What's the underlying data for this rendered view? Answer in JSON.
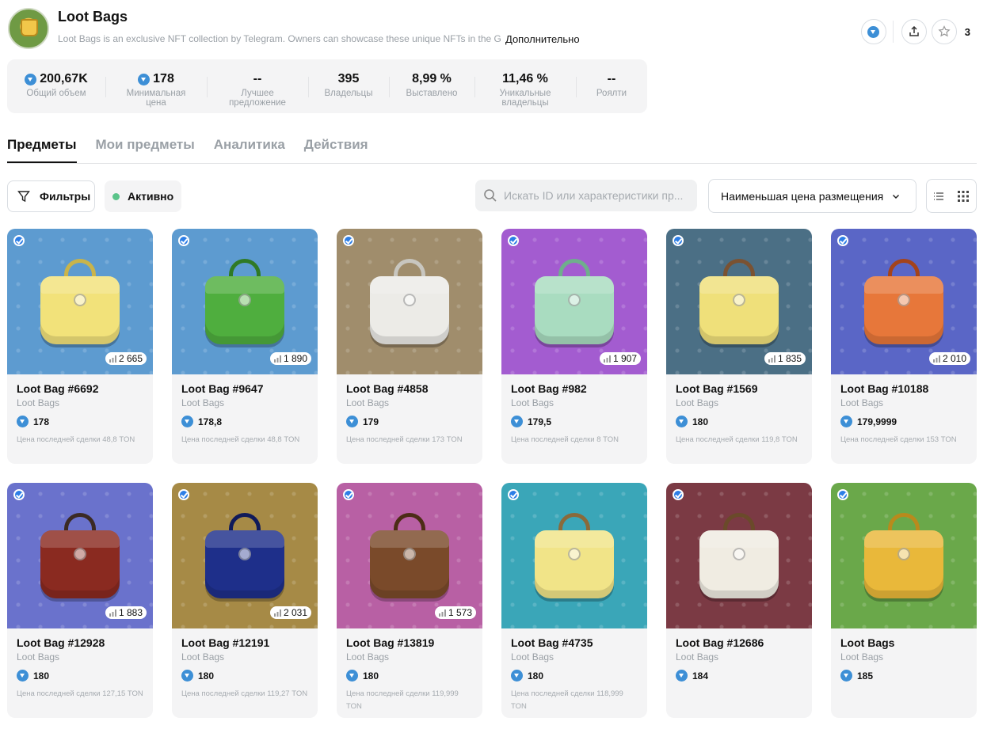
{
  "collection": {
    "title": "Loot Bags",
    "description": "Loot Bags is an exclusive NFT collection by Telegram. Owners can showcase these unique NFTs in the G",
    "more_link": "Дополнительно",
    "favorites_count": "3"
  },
  "stats": [
    {
      "value": "200,67K",
      "label": "Общий объем",
      "has_ton": true
    },
    {
      "value": "178",
      "label": "Минимальная цена",
      "has_ton": true
    },
    {
      "value": "--",
      "label": "Лучшее предложение",
      "has_ton": false
    },
    {
      "value": "395",
      "label": "Владельцы",
      "has_ton": false
    },
    {
      "value": "8,99 %",
      "label": "Выставлено",
      "has_ton": false
    },
    {
      "value": "11,46 %",
      "label": "Уникальные владельцы",
      "has_ton": false
    },
    {
      "value": "--",
      "label": "Роялти",
      "has_ton": false
    }
  ],
  "tabs": [
    {
      "label": "Предметы",
      "active": true
    },
    {
      "label": "Мои предметы",
      "active": false
    },
    {
      "label": "Аналитика",
      "active": false
    },
    {
      "label": "Действия",
      "active": false
    }
  ],
  "toolbar": {
    "filters_label": "Фильтры",
    "status_label": "Активно",
    "search_placeholder": "Искать ID или характеристики пр...",
    "sort_label": "Наименьшая цена размещения"
  },
  "items": [
    {
      "name": "Loot Bag #6692",
      "collection": "Loot Bags",
      "price": "178",
      "last_label": "Цена последней сделки",
      "last_price": "48,8 TON",
      "holders": "2 665",
      "bg": "#5d9bd0",
      "bag": "#f2e27a",
      "handle": "#c9b44a"
    },
    {
      "name": "Loot Bag #9647",
      "collection": "Loot Bags",
      "price": "178,8",
      "last_label": "Цена последней сделки",
      "last_price": "48,8 TON",
      "holders": "1 890",
      "bg": "#5d9bd0",
      "bag": "#4fae3e",
      "handle": "#2f7a25"
    },
    {
      "name": "Loot Bag #4858",
      "collection": "Loot Bags",
      "price": "179",
      "last_label": "Цена последней сделки",
      "last_price": "173 TON",
      "holders": "",
      "bg": "#a08d6c",
      "bag": "#ecebe7",
      "handle": "#c8c6bf"
    },
    {
      "name": "Loot Bag #982",
      "collection": "Loot Bags",
      "price": "179,5",
      "last_label": "Цена последней сделки",
      "last_price": "8 TON",
      "holders": "1 907",
      "bg": "#a35cd0",
      "bag": "#a9dcc0",
      "handle": "#6fae8c"
    },
    {
      "name": "Loot Bag #1569",
      "collection": "Loot Bags",
      "price": "180",
      "last_label": "Цена последней сделки",
      "last_price": "119,8 TON",
      "holders": "1 835",
      "bg": "#4b6f85",
      "bag": "#efe07a",
      "handle": "#7a5232"
    },
    {
      "name": "Loot Bag #10188",
      "collection": "Loot Bags",
      "price": "179,9999",
      "last_label": "Цена последней сделки",
      "last_price": "153 TON",
      "holders": "2 010",
      "bg": "#5a66c6",
      "bag": "#e7773a",
      "handle": "#a4431b"
    },
    {
      "name": "Loot Bag #12928",
      "collection": "Loot Bags",
      "price": "180",
      "last_label": "Цена последней сделки",
      "last_price": "127,15 TON",
      "holders": "1 883",
      "bg": "#6a72cc",
      "bag": "#8a2a20",
      "handle": "#3b2a24"
    },
    {
      "name": "Loot Bag #12191",
      "collection": "Loot Bags",
      "price": "180",
      "last_label": "Цена последней сделки",
      "last_price": "119,27 TON",
      "holders": "2 031",
      "bg": "#a68a46",
      "bag": "#1e2f8a",
      "handle": "#101a5a"
    },
    {
      "name": "Loot Bag #13819",
      "collection": "Loot Bags",
      "price": "180",
      "last_label": "Цена последней сделки",
      "last_price": "119,999 TON",
      "holders": "1 573",
      "bg": "#b860a4",
      "bag": "#7a4a2a",
      "handle": "#4c2c16"
    },
    {
      "name": "Loot Bag #4735",
      "collection": "Loot Bags",
      "price": "180",
      "last_label": "Цена последней сделки",
      "last_price": "118,999 TON",
      "holders": "",
      "bg": "#3aa6b8",
      "bag": "#f1e488",
      "handle": "#8a6a3a"
    },
    {
      "name": "Loot Bag #12686",
      "collection": "Loot Bags",
      "price": "184",
      "last_label": "",
      "last_price": "",
      "holders": "",
      "bg": "#7b3a44",
      "bag": "#f0ece2",
      "handle": "#6a4a2a"
    },
    {
      "name": "Loot Bags",
      "collection": "Loot Bags",
      "price": "185",
      "last_label": "",
      "last_price": "",
      "holders": "",
      "bg": "#6aa84a",
      "bag": "#e9b83a",
      "handle": "#b98a1c"
    }
  ]
}
